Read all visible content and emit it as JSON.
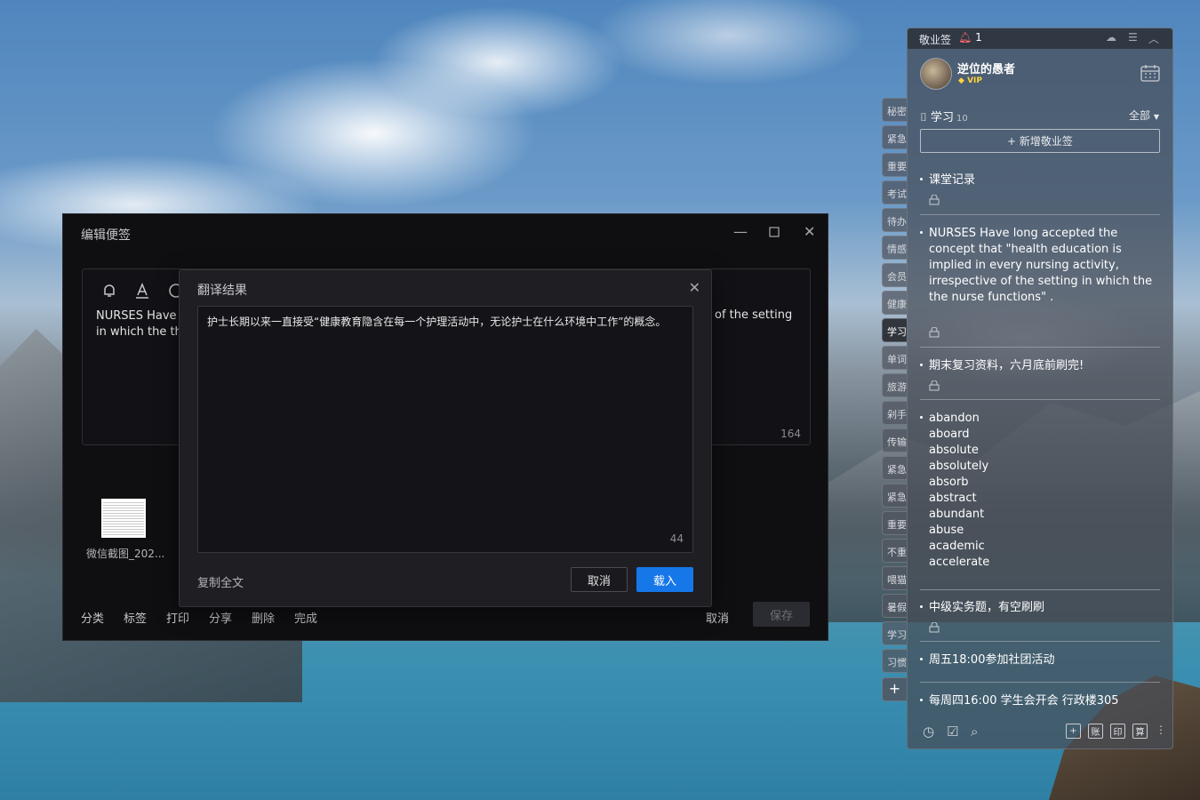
{
  "editor": {
    "title": "编辑便签",
    "text_left_line1": "NURSES Have l",
    "text_left_line2": "in which the th",
    "text_right": "of the setting",
    "char_count": "164",
    "attachment_name": "微信截图_202...",
    "actions": [
      "分类",
      "标签",
      "打印",
      "分享",
      "删除",
      "完成"
    ],
    "cancel_label": "取消",
    "save_label": "保存"
  },
  "dialog": {
    "title": "翻译结果",
    "translation": "护士长期以来一直接受“健康教育隐含在每一个护理活动中，无论护士在什么环境中工作”的概念。",
    "char_count": "44",
    "copy_all_label": "复制全文",
    "cancel_label": "取消",
    "load_label": "载入",
    "accent_color": "#1677e8"
  },
  "side_tabs": [
    "秘密",
    "紧急",
    "重要",
    "考试",
    "待办",
    "情感",
    "会员",
    "健康",
    "学习",
    "单词",
    "旅游",
    "剁手",
    "传输",
    "紧急",
    "紧急",
    "重要",
    "不重",
    "喂猫",
    "暑假",
    "学习",
    "习惯"
  ],
  "side_tab_active": "学习",
  "panel": {
    "app_name": "敬业签",
    "notification_count": "1",
    "username": "逆位的愚者",
    "vip_label": "VIP",
    "group_name": "学习",
    "group_count": "10",
    "filter_label": "全部",
    "new_note_label": "新增敬业签",
    "notes": [
      "课堂记录",
      "NURSES Have long accepted the concept that \"health education is implied in every nursing activity, irrespective of the setting in which the the nurse functions\" .",
      "期末复习资料，六月底前刷完!",
      "abandon\naboard\nabsolute\nabsolutely\nabsorb\nabstract\nabundant\nabuse\nacademic\naccelerate",
      "中级实务题，有空刷刷",
      "周五18:00参加社团活动",
      "每周四16:00 学生会开会 行政楼305"
    ],
    "footer_boxes": [
      "+",
      "账",
      "印",
      "算"
    ]
  }
}
